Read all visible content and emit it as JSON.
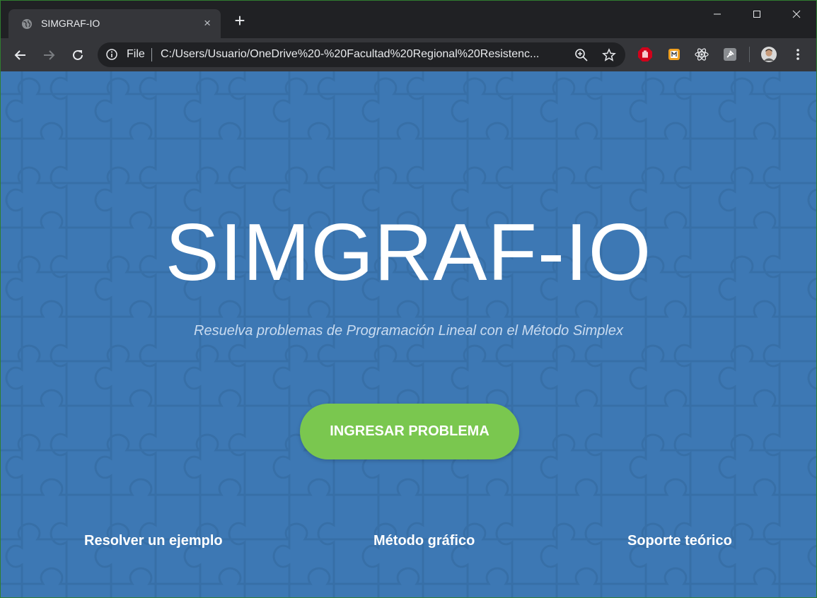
{
  "browser": {
    "tab_title": "SIMGRAF-IO",
    "tab_close": "×",
    "new_tab": "+",
    "scheme_label": "File",
    "url": "C:/Users/Usuario/OneDrive%20-%20Facultad%20Regional%20Resistenc..."
  },
  "page": {
    "title": "SIMGRAF-IO",
    "subtitle": "Resuelva problemas de Programación Lineal con el Método Simplex",
    "cta_label": "INGRESAR PROBLEMA",
    "links": [
      "Resolver un ejemplo",
      "Método gráfico",
      "Soporte teórico"
    ]
  },
  "colors": {
    "page_bg": "#3d78b4",
    "cta_bg": "#7ac74f",
    "chrome_dark": "#202124",
    "chrome_toolbar": "#35363a"
  },
  "icons": [
    "globe-icon",
    "close-icon",
    "plus-icon",
    "minimize-icon",
    "maximize-icon",
    "window-close-icon",
    "back-icon",
    "forward-icon",
    "reload-icon",
    "info-icon",
    "zoom-icon",
    "star-icon",
    "adblock-extension-icon",
    "extension-icon",
    "react-devtools-icon",
    "pin-extension-icon",
    "profile-avatar",
    "menu-icon"
  ]
}
